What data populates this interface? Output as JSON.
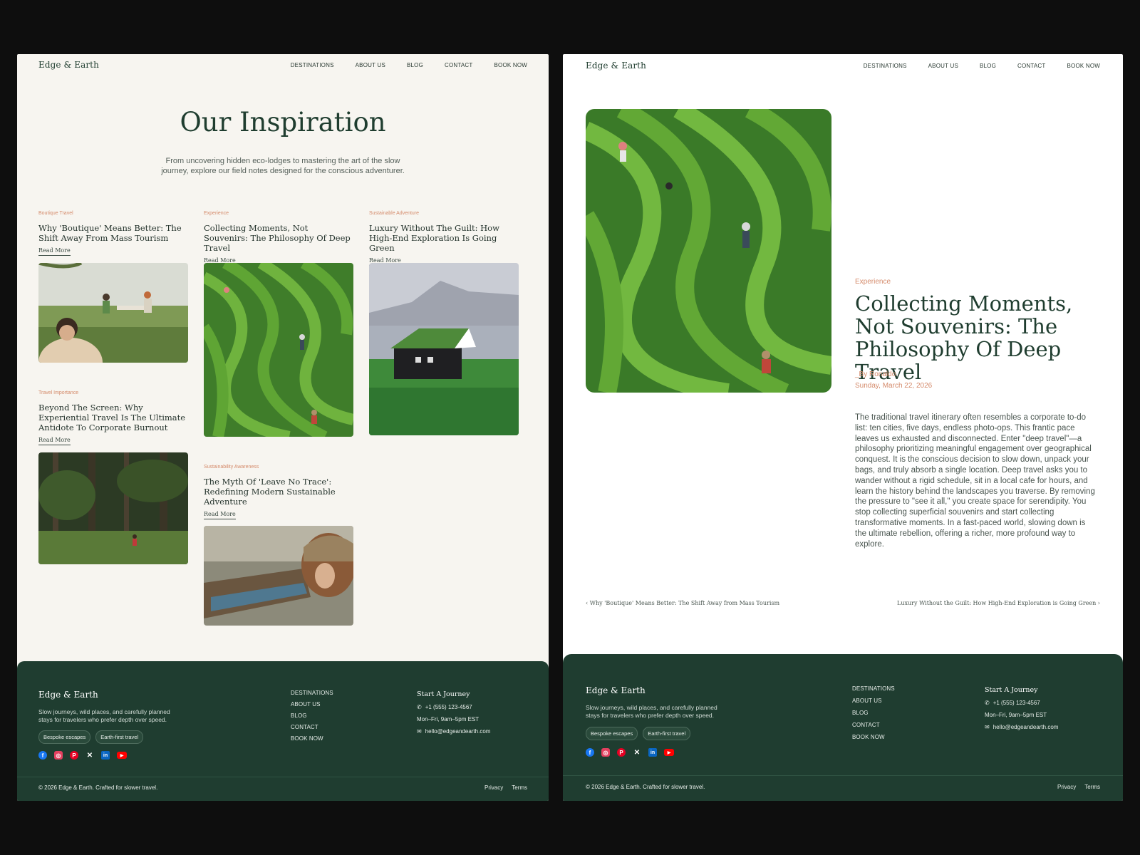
{
  "brand": "Edge & Earth",
  "nav": [
    "DESTINATIONS",
    "ABOUT US",
    "BLOG",
    "CONTACT",
    "BOOK NOW"
  ],
  "listing": {
    "title": "Our Inspiration",
    "subtitle": "From uncovering hidden eco-lodges to mastering the art of the slow journey, explore our field notes designed for the conscious adventurer.",
    "read_more": "Read More",
    "cards": [
      {
        "category": "Boutique Travel",
        "title": "Why 'Boutique' Means Better: The Shift Away From Mass Tourism"
      },
      {
        "category": "Experience",
        "title": "Collecting Moments, Not Souvenirs: The Philosophy Of Deep Travel"
      },
      {
        "category": "Sustainable Adventure",
        "title": "Luxury Without The Guilt: How High-End Exploration Is Going Green"
      },
      {
        "category": "Travel Importance",
        "title": "Beyond The Screen: Why Experiential Travel Is The Ultimate Antidote To Corporate Burnout"
      },
      {
        "category": "Sustainability Awareness",
        "title": "The Myth Of 'Leave No Trace': Redefining Modern Sustainable Adventure"
      }
    ]
  },
  "post": {
    "category": "Experience",
    "title": "Collecting Moments, Not Souvenirs: The Philosophy Of Deep Travel",
    "author": "_By Ronaldo",
    "date": "Sunday, March 22, 2026",
    "body": "The traditional travel itinerary often resembles a corporate to-do list: ten cities, five days, endless photo-ops. This frantic pace leaves us exhausted and disconnected. Enter \"deep travel\"—a philosophy prioritizing meaningful engagement over geographical conquest. It is the conscious decision to slow down, unpack your bags, and truly absorb a single location. Deep travel asks you to wander without a rigid schedule, sit in a local cafe for hours, and learn the history behind the landscapes you traverse. By removing the pressure to \"see it all,\" you create space for serendipity. You stop collecting superficial souvenirs and start collecting transformative moments. In a fast-paced world, slowing down is the ultimate rebellion, offering a richer, more profound way to explore.",
    "prev": "‹ Why 'Boutique' Means Better: The Shift Away from Mass Tourism",
    "next": "Luxury Without the Guilt: How High-End Exploration is Going Green ›"
  },
  "footer": {
    "brand": "Edge & Earth",
    "tagline": "Slow journeys, wild places, and carefully planned stays for travelers who prefer depth over speed.",
    "chips": [
      "Bespoke escapes",
      "Earth-first travel"
    ],
    "links": [
      "DESTINATIONS",
      "ABOUT US",
      "BLOG",
      "CONTACT",
      "BOOK NOW"
    ],
    "contact_title": "Start A Journey",
    "phone": "+1 (555) 123-4567",
    "hours": "Mon–Fri, 9am–5pm EST",
    "email": "hello@edgeandearth.com",
    "copyright": "© 2026 Edge & Earth. Crafted for slower travel.",
    "privacy": "Privacy",
    "terms": "Terms"
  },
  "colors": {
    "accent": "#d48a6a",
    "brand_green": "#1f3d2f",
    "footer_bg": "#1f3d30",
    "left_bg": "#f7f5f0"
  }
}
